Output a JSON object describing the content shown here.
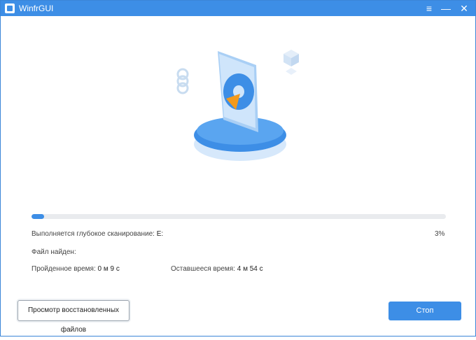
{
  "window": {
    "title": "WinfrGUI"
  },
  "titlebar": {
    "menu_icon": "hamburger-menu-icon",
    "minimize_icon": "minimize-icon",
    "close_icon": "close-icon"
  },
  "scan": {
    "progress_percent": 3,
    "status_label": "Выполняется глубокое сканирование:",
    "drive": "E:",
    "percent_text": "3%",
    "found_label": "Файл найден:",
    "elapsed_label": "Пройденное время:",
    "elapsed_value": "0 м 9 с",
    "remaining_label": "Оставшееся время:",
    "remaining_value": "4 м 54 с"
  },
  "buttons": {
    "view_recovered": "Просмотр восстановленных файлов",
    "stop": "Стоп"
  },
  "colors": {
    "accent": "#3d8ee6",
    "track": "#e9ebee"
  }
}
